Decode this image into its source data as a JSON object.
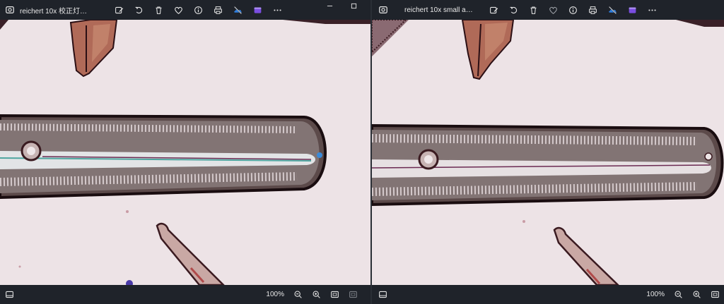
{
  "left_window": {
    "title": "reichert 10x 校正灯丝...",
    "zoom": "100%",
    "toolbar": [
      "edit-image-icon",
      "rotate-icon",
      "delete-icon",
      "favorite-icon",
      "info-icon",
      "print-icon",
      "onedrive-icon",
      "clipchamp-icon",
      "more-icon"
    ]
  },
  "right_window": {
    "title": "reichert 10x small apt...",
    "zoom": "100%",
    "toolbar": [
      "edit-image-icon",
      "rotate-icon",
      "delete-icon",
      "favorite-icon",
      "info-icon",
      "print-icon",
      "onedrive-icon",
      "clipchamp-icon",
      "more-icon"
    ]
  },
  "colors": {
    "chrome": "#1f232a",
    "image_background": "#ede3e6",
    "diatom_outline": "#2b0f14",
    "onedrive_blue": "#2f7fe0",
    "clipchamp_purple": "#7a4de0"
  }
}
